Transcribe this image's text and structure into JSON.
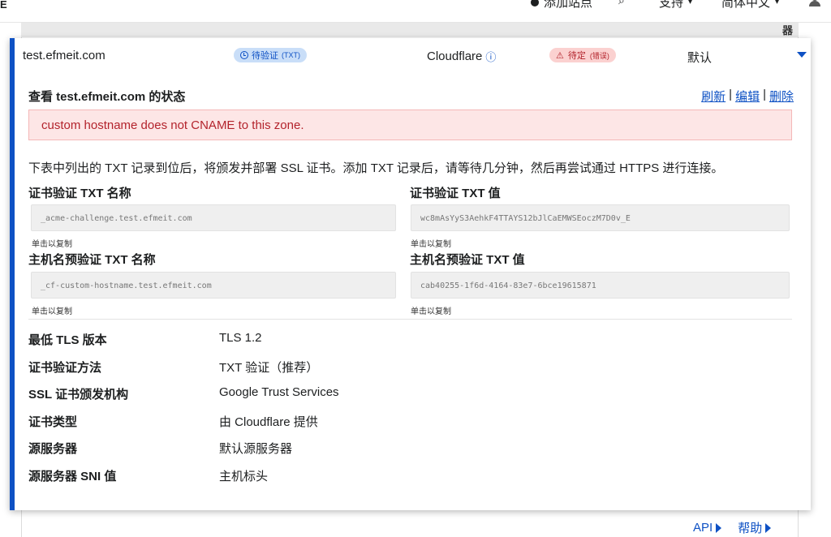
{
  "topnav": {
    "logo_fragment": "E",
    "add_site": "添加站点",
    "support": "支持",
    "language": "简体中文"
  },
  "table_head_glyph": "器",
  "row": {
    "hostname": "test.efmeit.com",
    "cert_status": "待验证",
    "cert_status_sub": "(TXT)",
    "cdn": "Cloudflare",
    "hostname_status": "待定",
    "hostname_status_sub": "(错误)",
    "origin": "默认"
  },
  "panel": {
    "title": "查看 test.efmeit.com 的状态",
    "actions": {
      "refresh": "刷新",
      "edit": "编辑",
      "delete": "删除",
      "sep": "|"
    },
    "error_message": "custom hostname does not CNAME to this zone.",
    "instructions": "下表中列出的 TXT 记录到位后，将颁发并部署 SSL 证书。添加 TXT 记录后，请等待几分钟，然后再尝试通过 HTTPS 进行连接。",
    "cert_txt_name_label": "证书验证 TXT 名称",
    "cert_txt_name_value": "_acme-challenge.test.efmeit.com",
    "cert_txt_value_label": "证书验证 TXT 值",
    "cert_txt_value_value": "wc8mAsYyS3AehkF4TTAYS12bJlCaEMWSEoczM7D0v_E",
    "host_txt_name_label": "主机名预验证 TXT 名称",
    "host_txt_name_value": "_cf-custom-hostname.test.efmeit.com",
    "host_txt_value_label": "主机名预验证 TXT 值",
    "host_txt_value_value": "cab40255-1f6d-4164-83e7-6bce19615871",
    "copy_hint": "单击以复制",
    "details": [
      {
        "label": "最低 TLS 版本",
        "value": "TLS 1.2"
      },
      {
        "label": "证书验证方法",
        "value": "TXT 验证（推荐）"
      },
      {
        "label": "SSL 证书颁发机构",
        "value": "Google Trust Services"
      },
      {
        "label": "证书类型",
        "value": "由 Cloudflare 提供"
      },
      {
        "label": "源服务器",
        "value": "默认源服务器"
      },
      {
        "label": "源服务器 SNI 值",
        "value": "主机标头"
      }
    ]
  },
  "footer": {
    "api": "API",
    "help": "帮助"
  },
  "colors": {
    "accent": "#0e51c4",
    "error": "#b3232c",
    "error_bg": "#fde6e6"
  }
}
